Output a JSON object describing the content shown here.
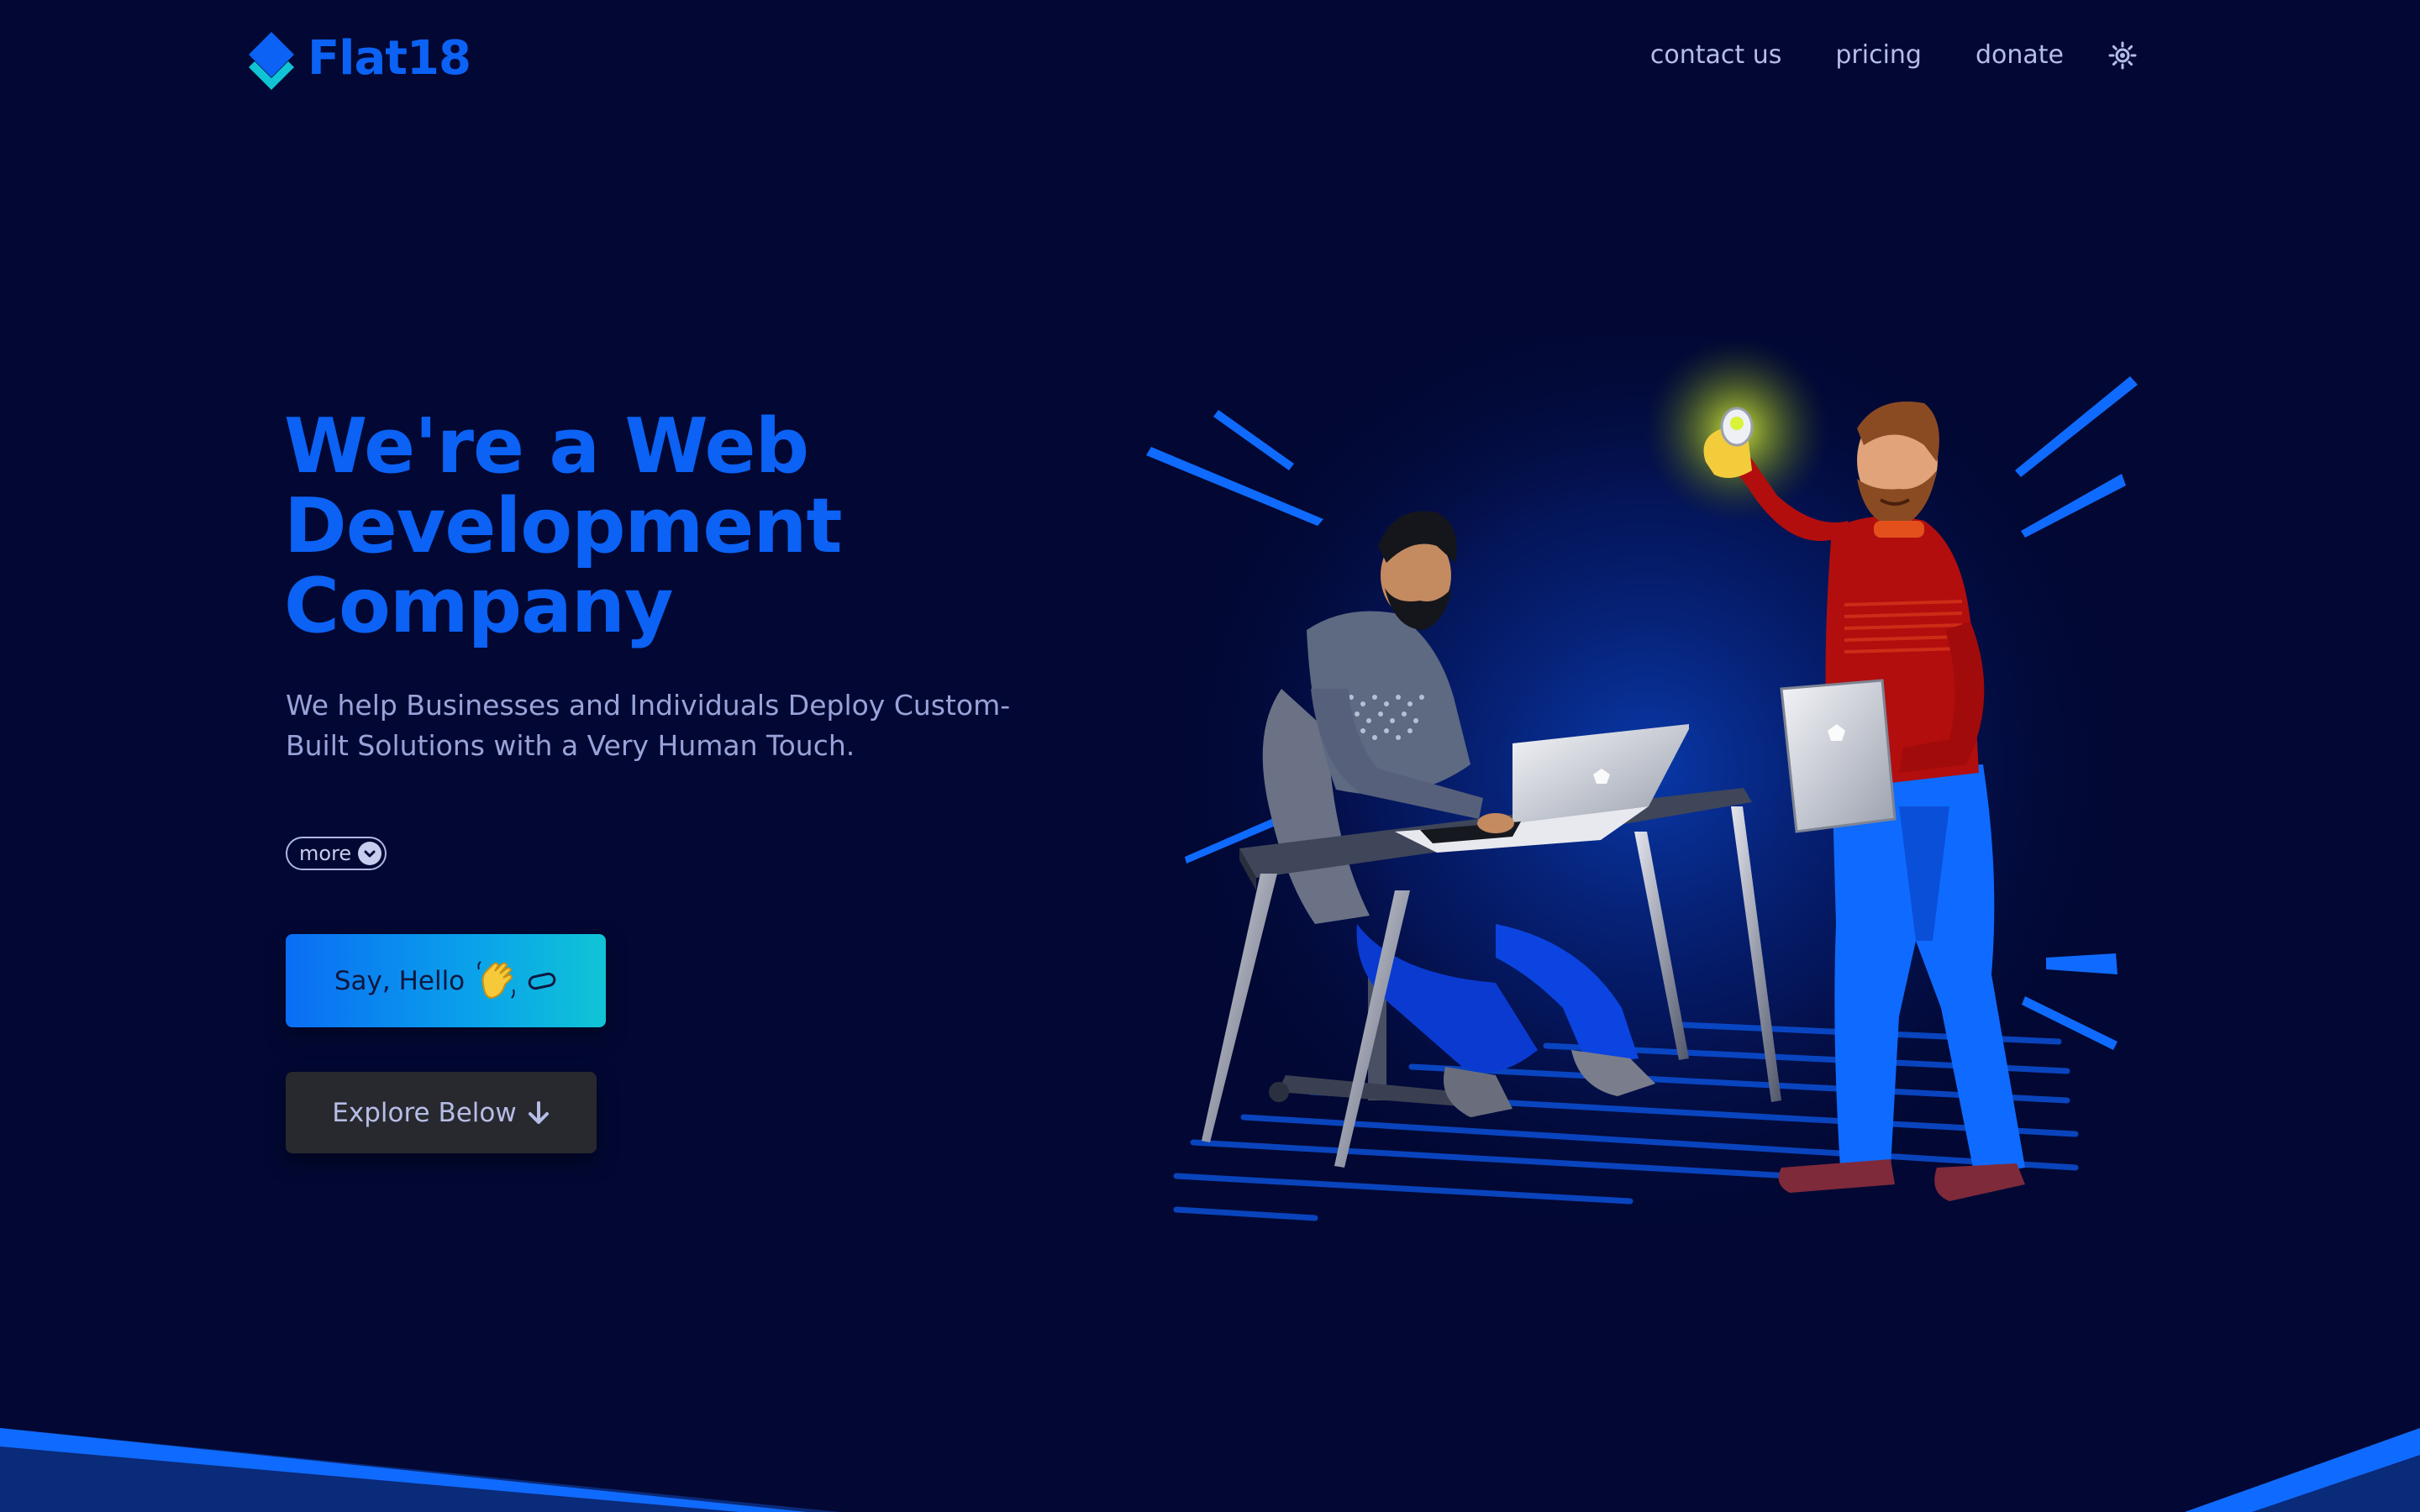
{
  "header": {
    "brand": "Flat18",
    "nav": [
      {
        "label": "contact us"
      },
      {
        "label": "pricing"
      },
      {
        "label": "donate"
      }
    ],
    "theme_icon": "sun-icon"
  },
  "hero": {
    "title_lines": [
      "We're a Web",
      "Development",
      "Company"
    ],
    "subtitle_lines": [
      "We help Businesses and Individuals Deploy Custom-",
      "Built Solutions with a Very Human Touch."
    ],
    "more_label": "more",
    "more_icon": "chevron-down-icon",
    "primary_button": {
      "label": "Say, Hello",
      "icons": [
        "waving-hand-icon",
        "link-icon"
      ]
    },
    "secondary_button": {
      "label": "Explore Below",
      "icon": "arrow-down-icon"
    }
  },
  "illustration": {
    "subject": "developer-and-idea-illustration"
  },
  "colors": {
    "background": "#020833",
    "accent": "#0b62f5",
    "accent_cyan": "#10c4d6",
    "muted_text": "#99a3d9",
    "secondary_button": "#28292f"
  }
}
